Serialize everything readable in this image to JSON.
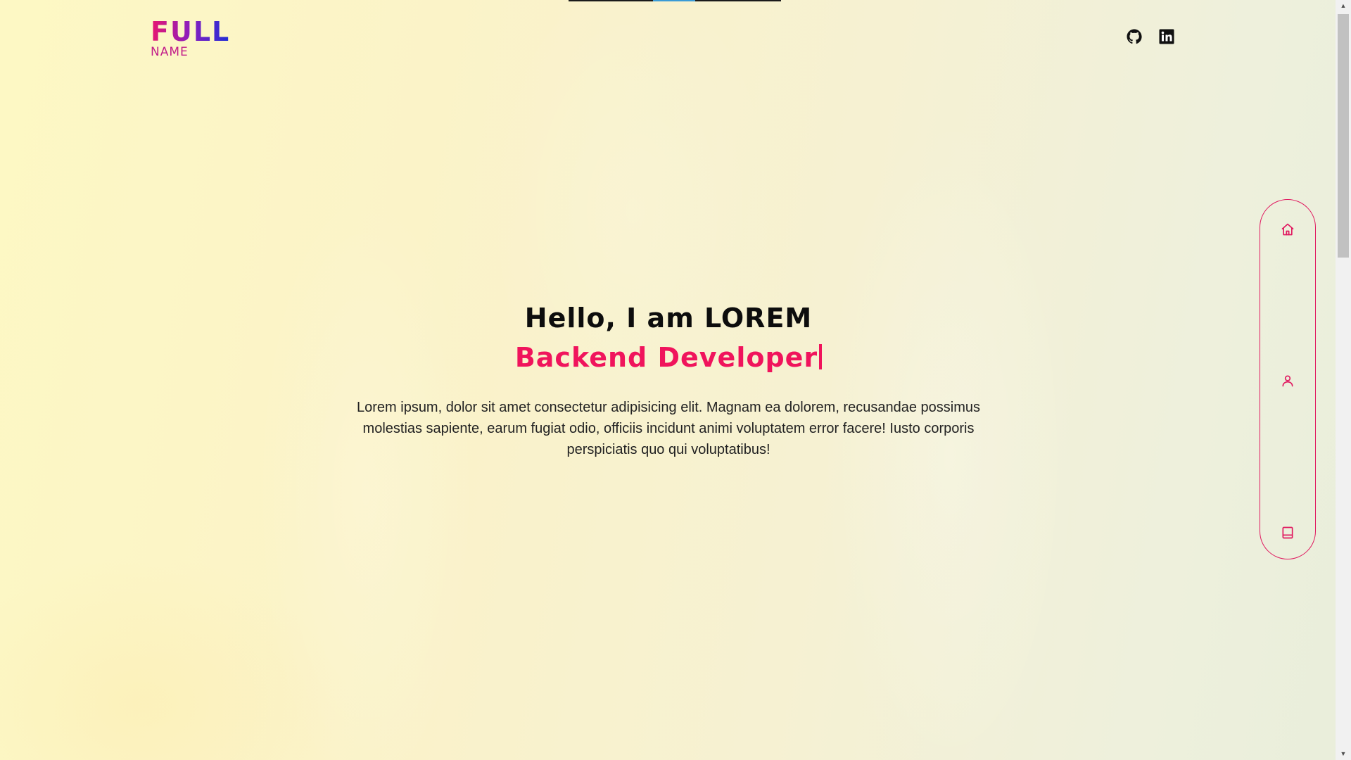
{
  "logo": {
    "main": "FULL",
    "sub": "NAME"
  },
  "social": [
    {
      "name": "GitHub",
      "icon": "github-icon"
    },
    {
      "name": "LinkedIn",
      "icon": "linkedin-icon"
    }
  ],
  "hero": {
    "greeting": "Hello, I am LOREM",
    "role": "Backend Developer",
    "description": "Lorem ipsum, dolor sit amet consectetur adipisicing elit. Magnam ea dolorem, recusandae possimus molestias sapiente, earum fugiat odio, officiis incidunt animi voluptatem error facere! Iusto corporis perspiciatis quo qui voluptatibus!"
  },
  "sidenav": {
    "items": [
      {
        "icon": "home-icon"
      },
      {
        "icon": "user-icon"
      },
      {
        "icon": "book-icon"
      }
    ]
  },
  "colors": {
    "accent": "#f0145c",
    "logo_gradient_start": "#e8166f",
    "logo_gradient_end": "#1e2fd6",
    "text": "#0d0d0d"
  }
}
